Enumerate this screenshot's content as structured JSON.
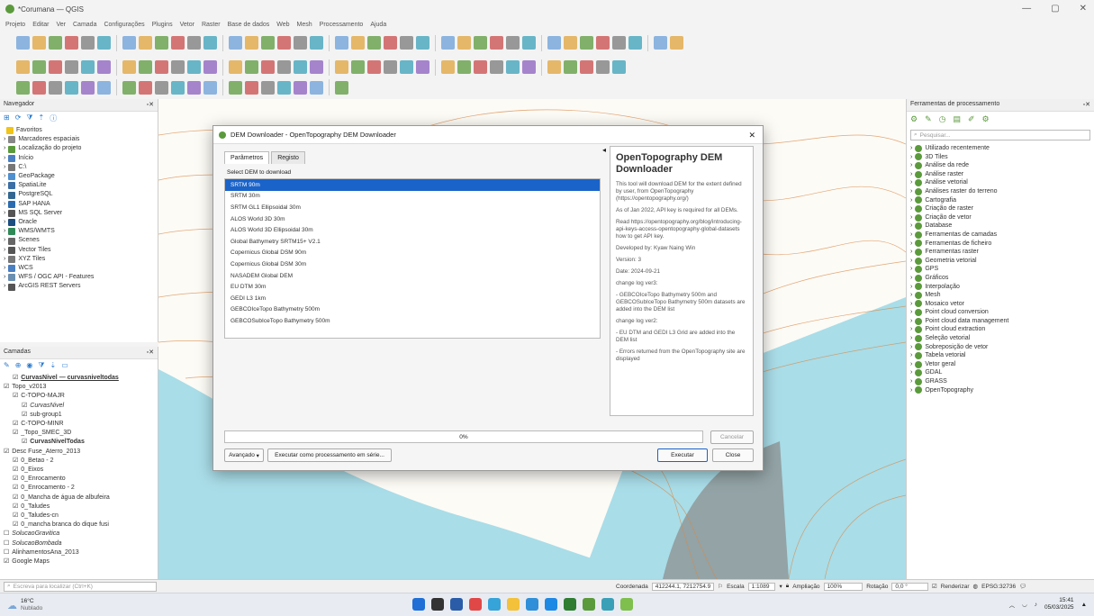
{
  "window": {
    "title": "*Corumana — QGIS"
  },
  "menu": [
    "Projeto",
    "Editar",
    "Ver",
    "Camada",
    "Configurações",
    "Plugins",
    "Vetor",
    "Raster",
    "Base de dados",
    "Web",
    "Mesh",
    "Processamento",
    "Ajuda"
  ],
  "navigator": {
    "title": "Navegador",
    "items": [
      "Favoritos",
      "Marcadores espaciais",
      "Localização do projeto",
      "Início",
      "C:\\",
      "GeoPackage",
      "SpatiaLite",
      "PostgreSQL",
      "SAP HANA",
      "MS SQL Server",
      "Oracle",
      "WMS/WMTS",
      "Scenes",
      "Vector Tiles",
      "XYZ Tiles",
      "WCS",
      "WFS / OGC API - Features",
      "ArcGIS REST Servers"
    ]
  },
  "layers": {
    "title": "Camadas",
    "items": [
      "CurvasNivel — curvasniveltodas",
      "Topo_v2013",
      "C-TOPO-MAJR",
      "CurvasNivel",
      "sub-group1",
      "C-TOPO-MINR",
      "_Topo_SMEC_3D",
      "CurvasNivelTodas",
      "Desc Fuse_Aterro_2013",
      "0_Betao - 2",
      "0_Eixos",
      "0_Enrocamento",
      "0_Enrocamento - 2",
      "0_Mancha de água de albufeira",
      "0_Taludes",
      "0_Taludes-cn",
      "0_mancha branca do dique fusi",
      "SolucaoGravitica",
      "SolucaoBombada",
      "AlinhamentosAna_2013",
      "Google Maps"
    ]
  },
  "dialog": {
    "title": "DEM Downloader - OpenTopography DEM Downloader",
    "tabs": [
      "Parâmetros",
      "Registo"
    ],
    "select_label": "Select DEM to download",
    "dem_options": [
      "SRTM 90m",
      "SRTM 30m",
      "SRTM GL1 Ellipsoidal 30m",
      "ALOS World 3D 30m",
      "ALOS World 3D Ellipsoidal 30m",
      "Global Bathymetry SRTM15+ V2.1",
      "Copernicus Global DSM 90m",
      "Copernicus Global DSM 30m",
      "NASADEM Global DEM",
      "EU DTM 30m",
      "GEDI L3 1km",
      "GEBCOIceTopo Bathymetry 500m",
      "GEBCOSubIceTopo Bathymetry 500m"
    ],
    "help_title": "OpenTopography DEM Downloader",
    "help": [
      "This tool will download DEM for the extent defined by user, from OpenTopography (https://opentopography.org/)",
      "As of Jan 2022, API key is required for all DEMs.",
      "Read https://opentopography.org/blog/introducing-api-keys-access-opentopography-global-datasets how to get API key.",
      "Developed by: Kyaw Naing Win",
      "Version: 3",
      "Date: 2024-09-21",
      "change log ver3:",
      "- GEBCOIceTopo Bathymetry 500m and GEBCOSubIceTopo Bathymetry 500m datasets are added into the DEM list",
      "change log ver2:",
      "- EU DTM and GEDI L3 Grid are added into the DEM list",
      "- Errors returned from the OpenTopography site are displayed"
    ],
    "progress": "0%",
    "progress_value": 0,
    "cancel": "Cancelar",
    "advanced": "Avançado",
    "batch": "Executar como processamento em série...",
    "run": "Executar",
    "close": "Close"
  },
  "processing": {
    "title": "Ferramentas de processamento",
    "search_placeholder": "Pesquisar...",
    "items": [
      "Utilizado recentemente",
      "3D Tiles",
      "Análise da rede",
      "Análise raster",
      "Análise vetorial",
      "Análises raster do terreno",
      "Cartografia",
      "Criação de raster",
      "Criação de vetor",
      "Database",
      "Ferramentas de camadas",
      "Ferramentas de ficheiro",
      "Ferramentas raster",
      "Geometria vetorial",
      "GPS",
      "Gráficos",
      "Interpolação",
      "Mesh",
      "Mosaico vetor",
      "Point cloud conversion",
      "Point cloud data management",
      "Point cloud extraction",
      "Seleção vetorial",
      "Sobreposição de vetor",
      "Tabela vetorial",
      "Vetor geral",
      "GDAL",
      "GRASS",
      "OpenTopography"
    ]
  },
  "status": {
    "locator_placeholder": "Escreva para localizar (Ctrl+K)",
    "coord_label": "Coordenada",
    "coord": "412244.1, 7212754.9",
    "scale_label": "Escala",
    "scale": "1:1089",
    "zoom_label": "Ampliação",
    "zoom": "100%",
    "rot_label": "Rotação",
    "rot": "0,0 °",
    "render": "Renderizar",
    "crs": "EPSG:32736"
  },
  "taskbar": {
    "temp": "16°C",
    "weather": "Nublado",
    "time": "15:41",
    "date": "05/03/2025"
  },
  "colors": {
    "accent": "#1a63c9",
    "qgis": "#5b9a3c",
    "water": "#a9dde8",
    "contour": "#d88a4a"
  }
}
